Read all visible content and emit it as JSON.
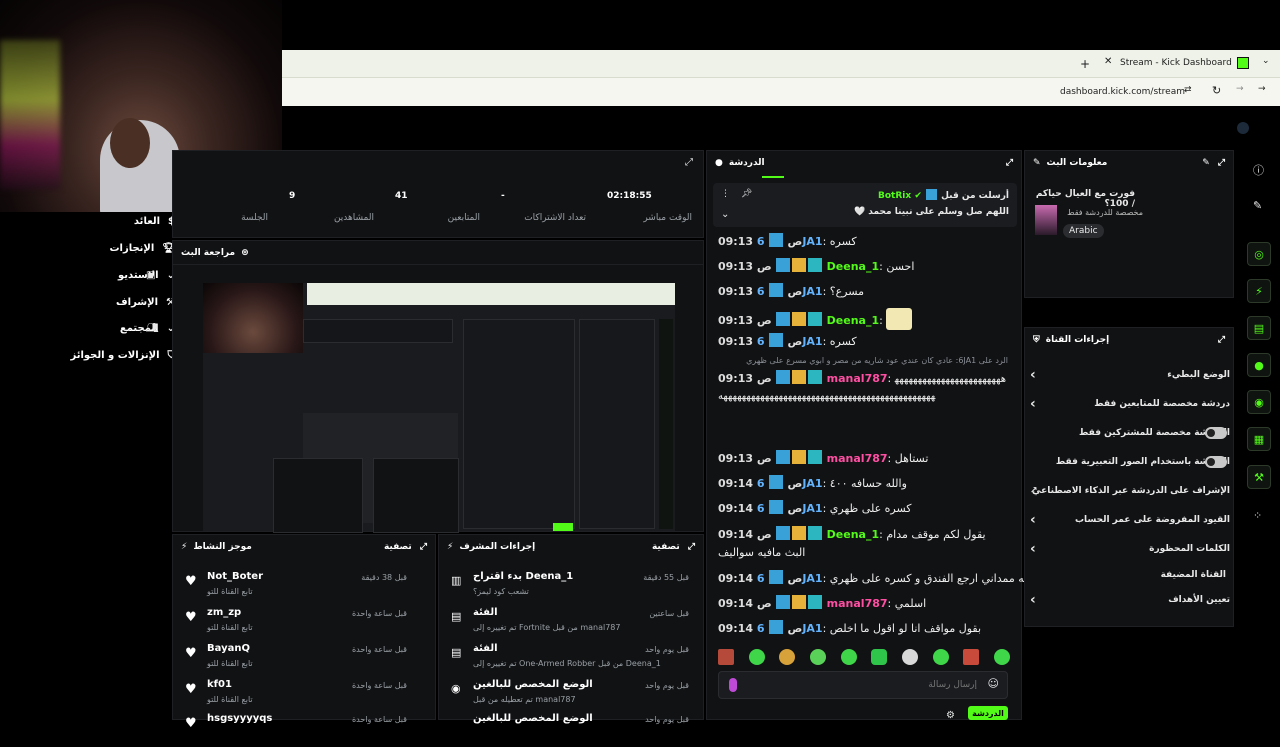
{
  "browser": {
    "tab_title": "Stream - Kick Dashboard",
    "url": "dashboard.kick.com/stream"
  },
  "sidebar": {
    "items": [
      {
        "label": "العائد",
        "icon": "dollar-icon"
      },
      {
        "label": "الإنجازات",
        "icon": "trophy-icon"
      },
      {
        "label": "الاستديو",
        "icon": "studio-icon"
      },
      {
        "label": "الإشراف",
        "icon": "wrench-icon"
      },
      {
        "label": "المجتمع",
        "icon": "community-icon"
      },
      {
        "label": "الإنزالات و الجوائز",
        "icon": "drops-icon"
      }
    ]
  },
  "stats": [
    {
      "value": "02:18:55",
      "label": "الوقت مباشر"
    },
    {
      "value": "-",
      "label": "تعداد الاشتراكات"
    },
    {
      "value": "41",
      "label": "المتابعين"
    },
    {
      "value": "9",
      "label": "المشاهدين"
    },
    {
      "value": "",
      "label": "الجلسة"
    }
  ],
  "preview": {
    "title": "مراجعة البث"
  },
  "chat": {
    "title": "الدردشة",
    "pinned_meta": "أرسلت من قبل",
    "pinned_user": "BotRix",
    "pinned_text": "اللهم صل وسلم على نبينا محمد 🤍",
    "reply_note": "الرد على 6JA1: عادي كان عندي عود شاريه من مصر و ابوي مسرع على ظهري",
    "messages": [
      {
        "time": "09:13 ص",
        "user": "6JA1",
        "text": "كسره",
        "color": "#62b4ff"
      },
      {
        "time": "09:13 ص",
        "user": "Deena_1",
        "text": "احسن",
        "color": "#53fc18"
      },
      {
        "time": "09:13 ص",
        "user": "6JA1",
        "text": "مسرع؟",
        "color": "#62b4ff"
      },
      {
        "time": "09:13 ص",
        "user": "Deena_1",
        "text": "",
        "color": "#53fc18"
      },
      {
        "time": "09:13 ص",
        "user": "6JA1",
        "text": "كسره",
        "color": "#62b4ff"
      },
      {
        "time": "09:13 ص",
        "user": "manal787",
        "text": "ههههههههههههههههههههههههههههههههههههههههههههههههههههههههههههههههههههههه",
        "color": "#ff4fa3"
      },
      {
        "time": "09:13 ص",
        "user": "manal787",
        "text": "تستاهل",
        "color": "#ff4fa3"
      },
      {
        "time": "09:14 ص",
        "user": "6JA1",
        "text": "والله حسافه ٤٠٠",
        "color": "#62b4ff"
      },
      {
        "time": "09:14 ص",
        "user": "6JA1",
        "text": "كسره على ظهري",
        "color": "#62b4ff"
      },
      {
        "time": "09:14 ص",
        "user": "Deena_1",
        "text": "يقول لكم موقف مدام البث مافيه سواليف",
        "color": "#53fc18"
      },
      {
        "time": "09:14 ص",
        "user": "6JA1",
        "text": "والله ممداني ارجع الفندق و كسره على ظهري",
        "color": "#62b4ff"
      },
      {
        "time": "09:14 ص",
        "user": "manal787",
        "text": "اسلمي",
        "color": "#ff4fa3"
      },
      {
        "time": "09:14 ص",
        "user": "6JA1",
        "text": "بقول مواقف انا لو اقول ما اخلص",
        "color": "#62b4ff"
      }
    ],
    "input_placeholder": "إرسال رسالة",
    "send_label": "الدردشة"
  },
  "stream_info": {
    "title": "معلومات البث",
    "stream_title": "فورت مع العيال حياكم / 100؟",
    "category": "مخصصة للدردشة فقط",
    "language": "Arabic"
  },
  "channel_actions": {
    "title": "إجراءات القناة",
    "items": [
      {
        "label": "الوضع البطيء",
        "control": "chevron"
      },
      {
        "label": "دردشة مخصصة للمتابعين فقط",
        "control": "chevron"
      },
      {
        "label": "الدردشة مخصصة للمشتركين فقط",
        "control": "toggle"
      },
      {
        "label": "الدردشة باستخدام الصور التعبيرية فقط",
        "control": "toggle"
      },
      {
        "label": "الإشراف على الدردشة عبر الذكاء الاصطناعي",
        "control": "link"
      },
      {
        "label": "القيود المفروضة على عمر الحساب",
        "control": "chevron"
      },
      {
        "label": "الكلمات المحظورة",
        "control": "chevron"
      },
      {
        "label": "القناة المضيفة",
        "control": "none"
      },
      {
        "label": "تعيين الأهداف",
        "control": "chevron"
      }
    ]
  },
  "activity": {
    "title": "موجز النشاط",
    "filter": "تصفية",
    "items": [
      {
        "name": "Not_Boter",
        "sub": "تابع القناة للتو",
        "time": "قبل 38 دقيقة"
      },
      {
        "name": "zm_zp",
        "sub": "تابع القناة للتو",
        "time": "قبل ساعة واحدة"
      },
      {
        "name": "BayanQ",
        "sub": "تابع القناة للتو",
        "time": "قبل ساعة واحدة"
      },
      {
        "name": "kf01",
        "sub": "تابع القناة للتو",
        "time": "قبل ساعة واحدة"
      },
      {
        "name": "hsgsyyyyqs",
        "sub": "",
        "time": "قبل ساعة واحدة"
      }
    ]
  },
  "mod_actions": {
    "title": "إجراءات المشرف",
    "filter": "تصفية",
    "items": [
      {
        "title": "بدء اقتراح Deena_1",
        "sub": "تشعب كود ليمز؟",
        "time": "قبل 55 دقيقة"
      },
      {
        "title": "الفئة",
        "sub": "تم تغييره إلى Fortnite من قبل manal787",
        "time": "قبل ساعتين"
      },
      {
        "title": "الفئة",
        "sub": "تم تغييره إلى One-Armed Robber من قبل Deena_1",
        "time": "قبل يوم واحد"
      },
      {
        "title": "الوضع المخصص للبالغين",
        "sub": "تم تعطيله من قبل manal787",
        "time": "قبل يوم واحد"
      },
      {
        "title": "الوضع المخصص للبالغين",
        "sub": "",
        "time": "قبل يوم واحد"
      }
    ]
  }
}
